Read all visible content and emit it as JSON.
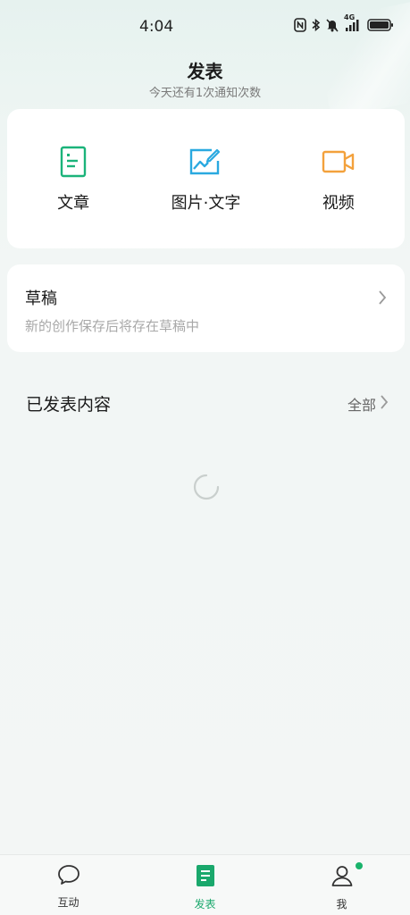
{
  "status_bar": {
    "time": "4:04",
    "network": "4G",
    "icons": [
      "nfc-icon",
      "bluetooth-icon",
      "mute-icon",
      "signal-icon",
      "battery-icon"
    ]
  },
  "header": {
    "title": "发表",
    "subtitle": "今天还有1次通知次数"
  },
  "publish": {
    "items": [
      {
        "label": "文章",
        "icon": "article-icon",
        "color": "#1bb37a"
      },
      {
        "label": "图片·文字",
        "icon": "image-text-icon",
        "color": "#2aa9e0"
      },
      {
        "label": "视频",
        "icon": "video-icon",
        "color": "#f3a13c"
      }
    ]
  },
  "drafts": {
    "title": "草稿",
    "subtitle": "新的创作保存后将存在草稿中"
  },
  "published": {
    "title": "已发表内容",
    "all_label": "全部"
  },
  "bottom_nav": {
    "items": [
      {
        "label": "互动",
        "icon": "chat-bubble-icon",
        "active": false
      },
      {
        "label": "发表",
        "icon": "publish-doc-icon",
        "active": true
      },
      {
        "label": "我",
        "icon": "user-icon",
        "active": false,
        "badge": true
      }
    ],
    "active_color": "#1aa86c",
    "badge_color": "#19b36b"
  }
}
